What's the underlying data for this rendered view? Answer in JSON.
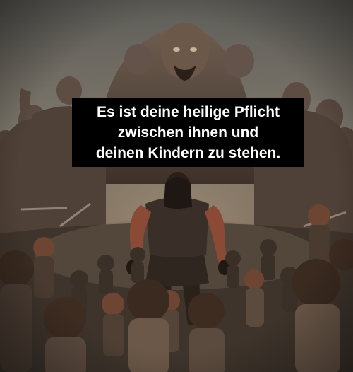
{
  "caption": {
    "line1": "Es ist deine heilige Pflicht",
    "line2": "zwischen ihnen und",
    "line3": "deinen Kindern zu stehen."
  },
  "colors": {
    "sky": "#6b6862",
    "ground": "#3e342c",
    "creature": "#5b4a3e",
    "warrior_skin": "#8a4a36",
    "caption_bg": "#000000",
    "caption_text": "#ffffff"
  }
}
